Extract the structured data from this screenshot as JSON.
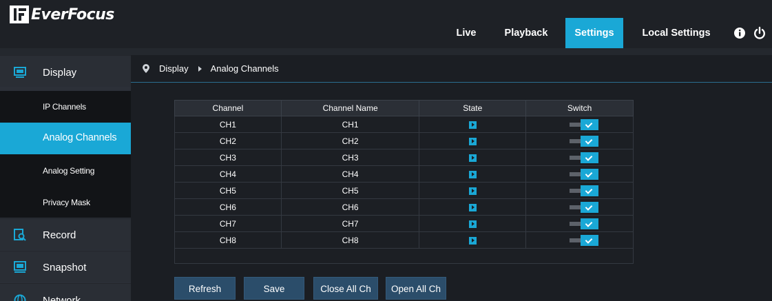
{
  "brand": {
    "name": "EverFocus",
    "accent": "#1aa8d6"
  },
  "topnav": {
    "items": [
      {
        "label": "Live"
      },
      {
        "label": "Playback"
      },
      {
        "label": "Settings",
        "active": true
      },
      {
        "label": "Local Settings"
      }
    ],
    "info_icon": "info-icon",
    "power_icon": "power-icon"
  },
  "sidebar": {
    "categories": [
      {
        "label": "Display",
        "icon": "monitor-icon"
      },
      {
        "label": "Record",
        "icon": "record-search-icon"
      },
      {
        "label": "Snapshot",
        "icon": "snapshot-icon"
      },
      {
        "label": "Network",
        "icon": "network-icon"
      }
    ],
    "display_items": [
      {
        "label": "IP Channels"
      },
      {
        "label": "Analog Channels",
        "active": true
      },
      {
        "label": "Analog Setting"
      },
      {
        "label": "Privacy Mask"
      }
    ]
  },
  "breadcrumb": {
    "root": "Display",
    "current": "Analog Channels"
  },
  "table": {
    "headers": [
      "Channel",
      "Channel Name",
      "State",
      "Switch"
    ],
    "rows": [
      {
        "channel": "CH1",
        "name": "CH1",
        "state": "play",
        "switch": true
      },
      {
        "channel": "CH2",
        "name": "CH2",
        "state": "play",
        "switch": true
      },
      {
        "channel": "CH3",
        "name": "CH3",
        "state": "play",
        "switch": true
      },
      {
        "channel": "CH4",
        "name": "CH4",
        "state": "play",
        "switch": true
      },
      {
        "channel": "CH5",
        "name": "CH5",
        "state": "play",
        "switch": true
      },
      {
        "channel": "CH6",
        "name": "CH6",
        "state": "play",
        "switch": true
      },
      {
        "channel": "CH7",
        "name": "CH7",
        "state": "play",
        "switch": true
      },
      {
        "channel": "CH8",
        "name": "CH8",
        "state": "play",
        "switch": true
      }
    ]
  },
  "buttons": {
    "refresh": "Refresh",
    "save": "Save",
    "close_all": "Close All Ch",
    "open_all": "Open All Ch"
  }
}
